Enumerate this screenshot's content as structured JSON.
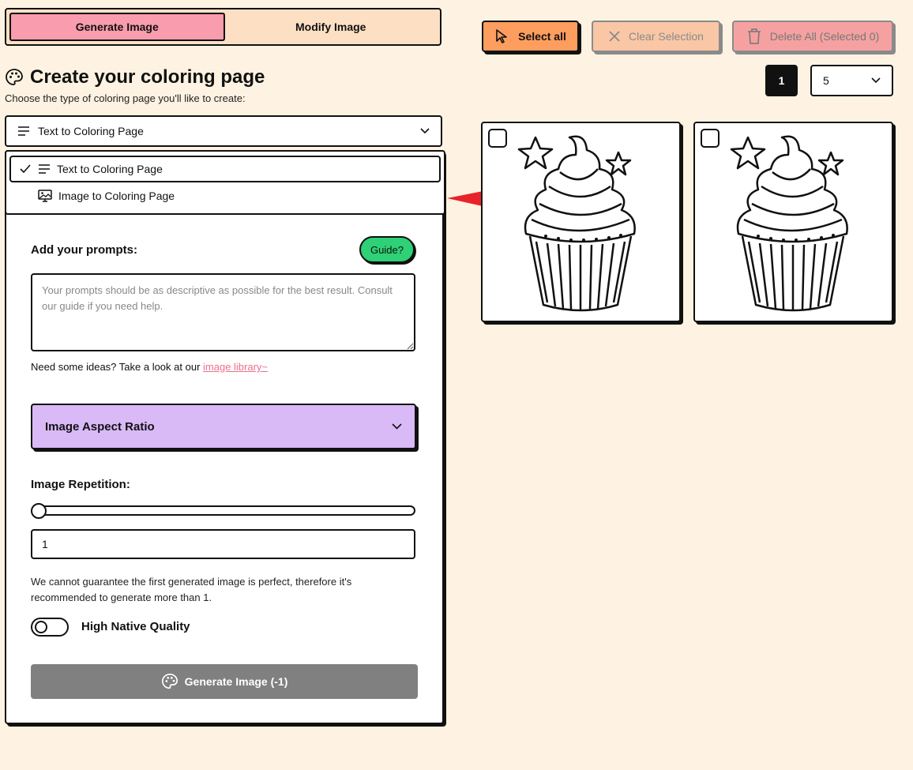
{
  "mode_tabs": {
    "generate": "Generate Image",
    "modify": "Modify Image"
  },
  "actions": {
    "select_all": "Select all",
    "clear_selection": "Clear Selection",
    "delete_all": "Delete All (Selected 0)"
  },
  "pagination": {
    "current_page": "1",
    "per_page": "5"
  },
  "header": {
    "title": "Create your coloring page",
    "subtitle": "Choose the type of coloring page you'll like to create:"
  },
  "type_select": {
    "value": "Text to Coloring Page",
    "options": [
      {
        "label": "Text to Coloring Page",
        "icon": "lines-icon",
        "selected": true
      },
      {
        "label": "Image to Coloring Page",
        "icon": "image-monitor-icon",
        "selected": false
      }
    ]
  },
  "prompts": {
    "label": "Add your prompts:",
    "guide_label": "Guide?",
    "placeholder": "Your prompts should be as descriptive as possible for the best result. Consult our guide if you need help.",
    "ideas_text": "Need some ideas? Take a look at our ",
    "ideas_link": "image library~"
  },
  "aspect": {
    "label": "Image Aspect Ratio"
  },
  "repetition": {
    "label": "Image Repetition:",
    "value": "1",
    "slider_fraction": 0,
    "note": "We cannot guarantee the first generated image is perfect, therefore it's recommended to generate more than 1."
  },
  "quality": {
    "label": "High Native Quality",
    "enabled": false
  },
  "generate_button": "Generate Image (-1)",
  "results": [
    {
      "subject": "cupcake coloring page",
      "checked": false
    },
    {
      "subject": "cupcake coloring page",
      "checked": false
    }
  ],
  "colors": {
    "background": "#fef3e2",
    "tab_active": "#f99cae",
    "select_all": "#fd9d5e",
    "guide": "#2ed176",
    "aspect": "#dab9f7",
    "generate_disabled": "#808080",
    "arrow": "#e8242a",
    "link": "#ef6f8c"
  }
}
